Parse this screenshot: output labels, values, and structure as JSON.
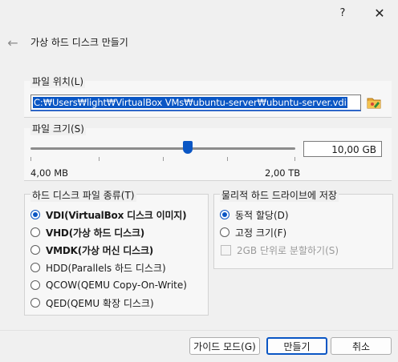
{
  "titlebar": {
    "help_label": "?",
    "close_label": "✕"
  },
  "header": {
    "back_icon": "back-arrow-icon",
    "title": "가상 하드 디스크 만들기"
  },
  "file_location": {
    "legend": "파일 위치(L)",
    "value": "C:\\Users\\light\\VirtualBox VMs\\ubuntu-server\\ubuntu-server.vdi",
    "display_value": "C:₩Users₩light₩VirtualBox VMs₩ubuntu-server₩ubuntu-server.vdi",
    "browse_icon": "folder-icon"
  },
  "file_size": {
    "legend": "파일 크기(S)",
    "value": "10.00 GB",
    "display_value": "10,00 GB",
    "slider_position": 0.58,
    "min_label": "4,00 MB",
    "max_label": "2,00 TB"
  },
  "disk_type": {
    "legend": "하드 디스크 파일 종류(T)",
    "options": [
      {
        "label": "VDI(VirtualBox 디스크 이미지)",
        "checked": true,
        "bold": true
      },
      {
        "label": "VHD(가상 하드 디스크)",
        "checked": false,
        "bold": true
      },
      {
        "label": "VMDK(가상 머신 디스크)",
        "checked": false,
        "bold": true
      },
      {
        "label": "HDD(Parallels 하드 디스크)",
        "checked": false,
        "bold": false
      },
      {
        "label": "QCOW(QEMU Copy-On-Write)",
        "checked": false,
        "bold": false
      },
      {
        "label": "QED(QEMU 확장 디스크)",
        "checked": false,
        "bold": false
      }
    ]
  },
  "storage": {
    "legend": "물리적 하드 드라이브에 저장",
    "options": [
      {
        "label": "동적 할당(D)",
        "checked": true
      },
      {
        "label": "고정 크기(F)",
        "checked": false
      }
    ],
    "split_label": "2GB 단위로 분할하기(S)",
    "split_checked": false,
    "split_enabled": false
  },
  "footer": {
    "guided_label": "가이드 모드(G)",
    "create_label": "만들기",
    "cancel_label": "취소"
  },
  "colors": {
    "accent": "#0a56c4",
    "background": "#f0f0f0"
  }
}
